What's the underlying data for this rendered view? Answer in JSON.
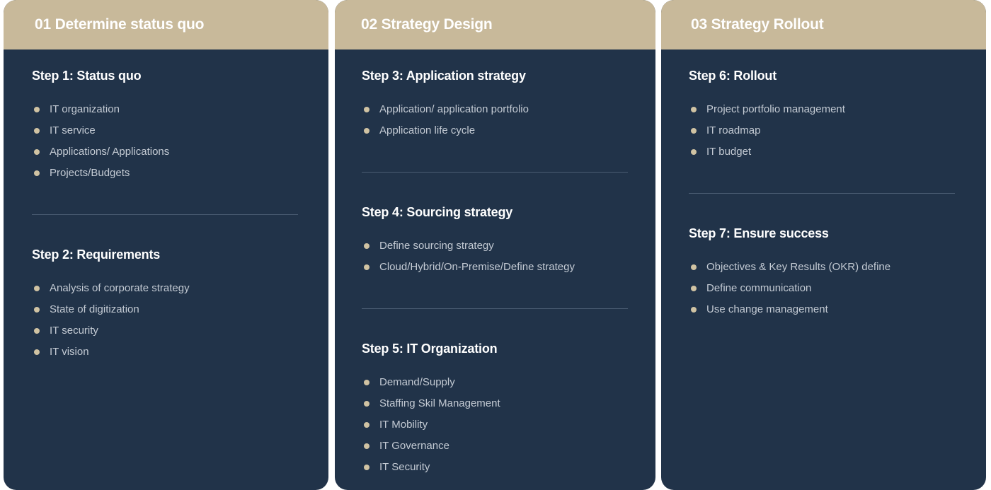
{
  "columns": [
    {
      "title": "01 Determine status quo",
      "steps": [
        {
          "title": "Step 1: Status quo",
          "items": [
            "IT organization",
            "IT service",
            "Applications/ Applications",
            "Projects/Budgets"
          ]
        },
        {
          "title": "Step 2: Requirements",
          "items": [
            "Analysis of corporate strategy",
            "State of digitization",
            "IT security",
            "IT vision"
          ]
        }
      ]
    },
    {
      "title": "02 Strategy Design",
      "steps": [
        {
          "title": "Step 3: Application strategy",
          "items": [
            "Application/ application portfolio",
            "Application life cycle"
          ]
        },
        {
          "title": "Step 4: Sourcing strategy",
          "items": [
            "Define sourcing strategy",
            "Cloud/Hybrid/On-Premise/Define strategy"
          ]
        },
        {
          "title": "Step 5: IT Organization",
          "items": [
            "Demand/Supply",
            "Staffing Skil Management",
            "IT Mobility",
            "IT Governance",
            "IT Security"
          ]
        }
      ]
    },
    {
      "title": "03 Strategy Rollout",
      "steps": [
        {
          "title": "Step 6: Rollout",
          "items": [
            "Project portfolio management",
            "IT roadmap",
            "IT budget"
          ]
        },
        {
          "title": "Step 7: Ensure success",
          "items": [
            "Objectives & Key Results (OKR) define",
            "Define communication",
            "Use change management"
          ]
        }
      ]
    }
  ],
  "colors": {
    "panel": "#213349",
    "header": "#c8b99a",
    "bullet": "#d0c3a3",
    "item_text": "#c3cad3",
    "title_text": "#ffffff",
    "divider": "#4a5c72"
  }
}
